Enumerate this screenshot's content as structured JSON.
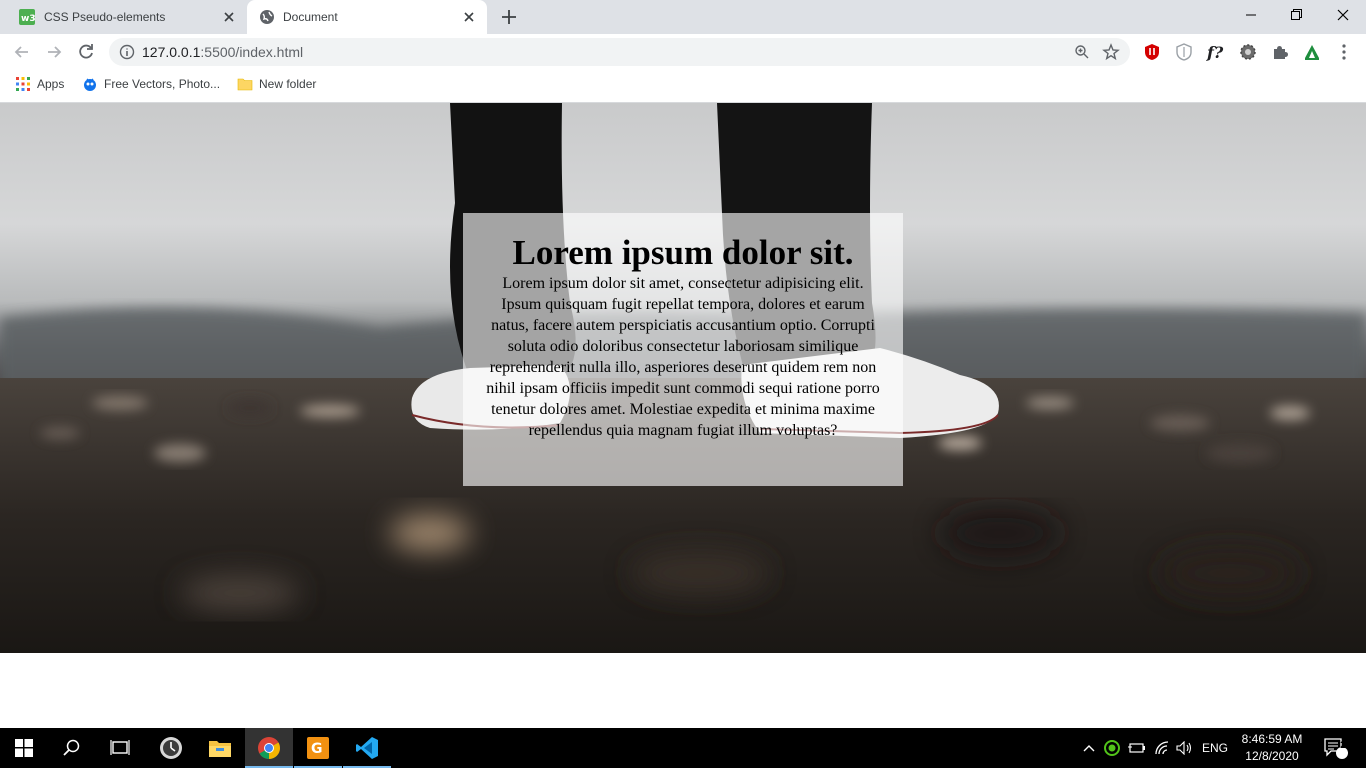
{
  "tabs": [
    {
      "title": "CSS Pseudo-elements",
      "favicon": "w3schools-icon",
      "active": false
    },
    {
      "title": "Document",
      "favicon": "globe-icon",
      "active": true
    }
  ],
  "address_bar": {
    "url_host": "127.0.0.1",
    "url_path": ":5500/index.html"
  },
  "bookmarks": [
    {
      "label": "Apps",
      "icon": "apps-grid-icon"
    },
    {
      "label": "Free Vectors, Photo...",
      "icon": "freepik-icon"
    },
    {
      "label": "New folder",
      "icon": "folder-icon"
    }
  ],
  "page": {
    "heading": "Lorem ipsum dolor sit.",
    "body": "Lorem ipsum dolor sit amet, consectetur adipisicing elit. Ipsum quisquam fugit repellat tempora, dolores et earum natus, facere autem perspiciatis accusantium optio. Corrupti soluta odio doloribus consectetur laboriosam similique reprehenderit nulla illo, asperiores deserunt quidem rem non nihil ipsam officiis impedit sunt commodi sequi ratione porro tenetur dolores amet. Molestiae expedita et minima maxime repellendus quia magnam fugiat illum voluptas?"
  },
  "taskbar": {
    "language": "ENG",
    "time": "8:46:59 AM",
    "date": "12/8/2020",
    "notification_count": "2"
  },
  "colors": {
    "tab_strip": "#dee1e6",
    "omnibox": "#f1f3f4",
    "card_overlay": "rgba(255,255,255,0.62)",
    "taskbar": "#000000",
    "taskbar_accent": "#76b9ed"
  }
}
